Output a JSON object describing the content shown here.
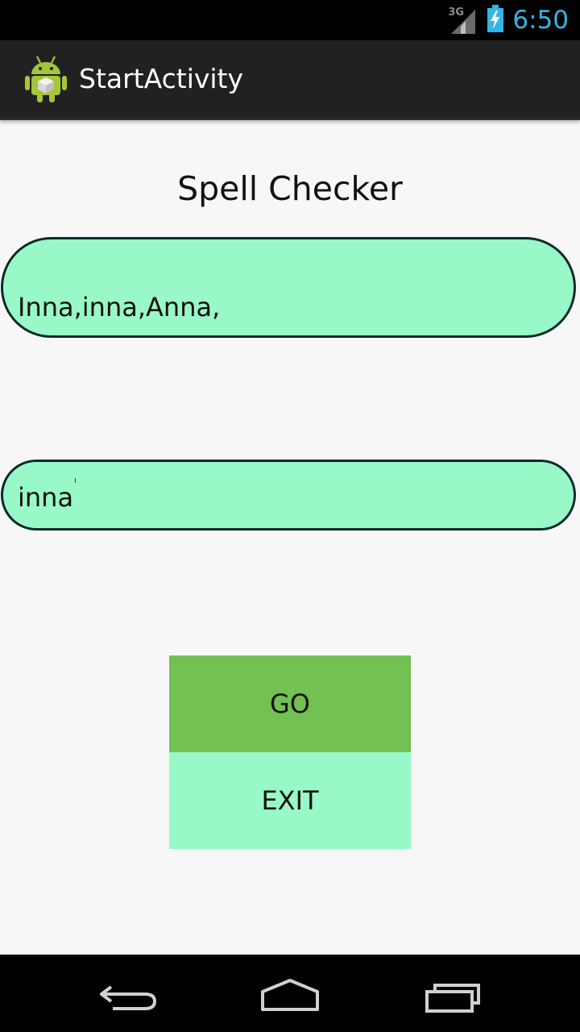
{
  "status_bar": {
    "network_type": "3G",
    "time": "6:50",
    "icons": [
      "signal-icon",
      "battery-charging-icon"
    ]
  },
  "action_bar": {
    "title": "StartActivity",
    "icon": "android-app-icon"
  },
  "main": {
    "heading": "Spell Checker",
    "suggestions": "Inna,inna,Anna,",
    "input_value": "inna",
    "go_label": "GO",
    "exit_label": "EXIT"
  },
  "nav_bar": {
    "icons": [
      "back-icon",
      "home-icon",
      "recent-apps-icon"
    ]
  },
  "colors": {
    "accent_blue": "#33b5e5",
    "field_green": "#98f8c8",
    "go_green": "#72c152",
    "border_dark": "#0d2b2b"
  }
}
